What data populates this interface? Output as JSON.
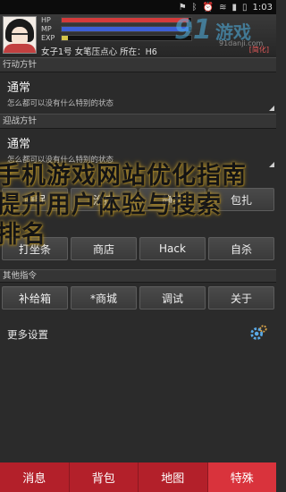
{
  "status_bar": {
    "time": "1:03",
    "icons": [
      "flag-icon",
      "bluetooth-icon",
      "alarm-icon",
      "wifi-icon",
      "signal-icon",
      "battery-icon"
    ]
  },
  "header": {
    "stats": [
      {
        "label": "HP",
        "fill": 0.98,
        "color": "#d43a3a"
      },
      {
        "label": "MP",
        "fill": 0.98,
        "color": "#3d5fd6"
      },
      {
        "label": "EXP",
        "fill": 0.05,
        "color": "#d3c34a"
      }
    ],
    "character_info": "女子1号 女笔压点心 所在：H6",
    "right_tag": "[简化]"
  },
  "watermark": {
    "number": "91",
    "text": "游戏",
    "url": "91danji.com"
  },
  "sections": {
    "action": {
      "title": "行动方针",
      "value": "通常",
      "description": "怎么都可以没有什么特别的状态"
    },
    "battle": {
      "title": "迎战方针",
      "value": "通常",
      "description": "怎么都可以没有什么特别的状态"
    }
  },
  "buttons_row1": [
    "睡眠",
    "治疗",
    "静养",
    "包扎"
  ],
  "buttons_row2": [
    "打坐条",
    "商店",
    "Hack",
    "自杀"
  ],
  "other_title": "其他指令",
  "buttons_row3": [
    "补给箱",
    "*商城",
    "调试",
    "关于"
  ],
  "more_settings": "更多设置",
  "overlay_lines": [
    "手机游戏网站优化指南",
    "提升用户体验与搜索",
    "排名"
  ],
  "tabs": [
    {
      "label": "消息",
      "active": false
    },
    {
      "label": "背包",
      "active": false
    },
    {
      "label": "地图",
      "active": false
    },
    {
      "label": "特殊",
      "active": true
    }
  ]
}
